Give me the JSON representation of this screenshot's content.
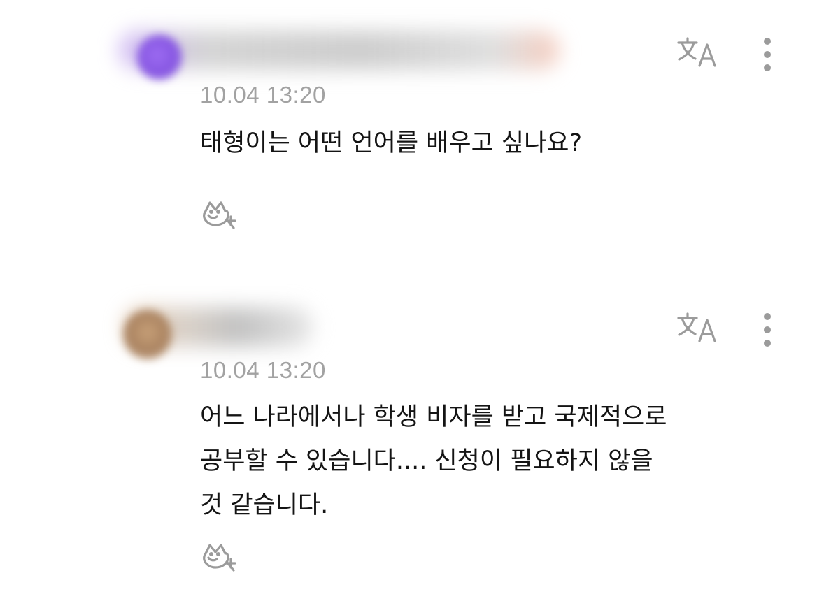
{
  "comments": [
    {
      "timestamp": "10.04 13:20",
      "lines": [
        "태형이는 어떤 언어를 배우고 싶나요?"
      ],
      "icons": {
        "translate": "translate-icon",
        "more": "more-vertical-icon",
        "react": "add-reaction-icon"
      }
    },
    {
      "timestamp": "10.04 13:20",
      "lines": [
        "어느 나라에서나 학생 비자를 받고 국제적으로",
        "공부할 수 있습니다.... 신청이 필요하지 않을",
        "것 같습니다."
      ],
      "icons": {
        "translate": "translate-icon",
        "more": "more-vertical-icon",
        "react": "add-reaction-icon"
      }
    }
  ],
  "colors": {
    "text": "#141414",
    "timestamp": "#a2a2a2",
    "icon": "#9b9b9b",
    "background": "#ffffff"
  }
}
